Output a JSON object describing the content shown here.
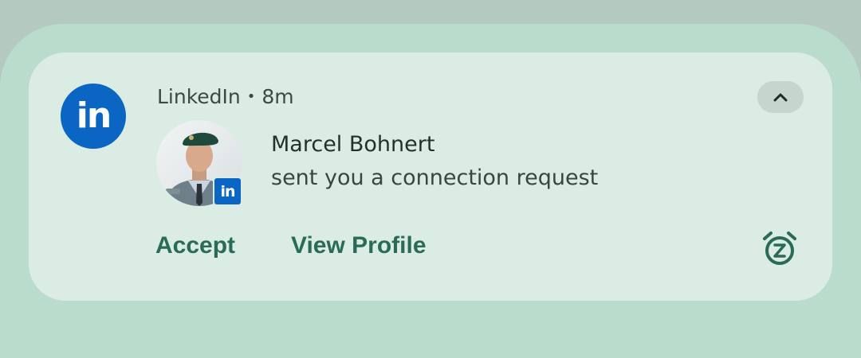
{
  "notification": {
    "app_icon_text": "in",
    "app_name": "LinkedIn",
    "separator": "•",
    "time": "8m",
    "title": "Marcel Bohnert",
    "body": "sent you a connection request",
    "avatar_badge_text": "in",
    "actions": [
      {
        "label": "Accept"
      },
      {
        "label": "View Profile"
      }
    ],
    "collapse_icon": "chevron-up-icon",
    "snooze_icon": "snooze-alarm-icon"
  },
  "colors": {
    "linkedin_blue": "#0a66c2",
    "card_background": "#daece4",
    "shade_background": "#b9dccd",
    "action_text": "#2a6b57"
  }
}
